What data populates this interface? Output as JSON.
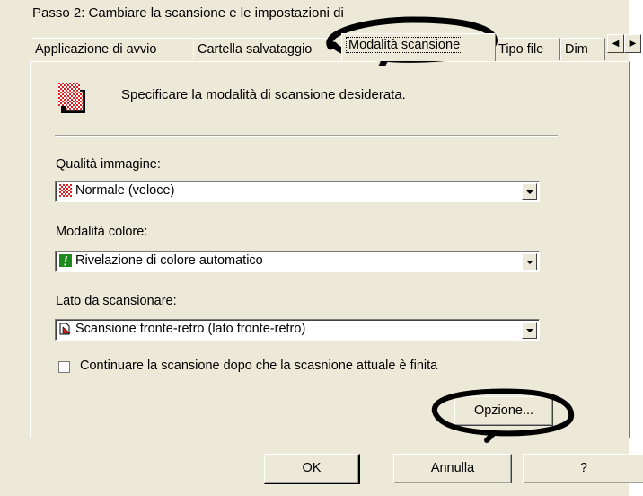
{
  "window": {
    "title": "Passo 2: Cambiare la scansione e le impostazioni di"
  },
  "tabs": [
    {
      "label": "Applicazione di avvio"
    },
    {
      "label": "Cartella salvataggio"
    },
    {
      "label": "Modalità scansione",
      "active": true
    },
    {
      "label": "Tipo file"
    },
    {
      "label": "Dim"
    }
  ],
  "tab_scroll": {
    "left_icon": "triangle-left-icon",
    "right_icon": "triangle-right-icon"
  },
  "header": {
    "icon": "scan-mode-checker-icon",
    "text": "Specificare la modalità di scansione desiderata."
  },
  "image_quality": {
    "label": "Qualità immagine:",
    "value": "Normale (veloce)",
    "icon": "red-checker-icon"
  },
  "color_mode": {
    "label": "Modalità colore:",
    "value": "Rivelazione di colore automatico",
    "icon": "green-exclamation-icon"
  },
  "scan_side": {
    "label": "Lato da scansionare:",
    "value": "Scansione fronte-retro (lato fronte-retro)",
    "icon": "duplex-page-icon"
  },
  "continue_scan": {
    "label": "Continuare la scansione dopo che la scasnione attuale è finita",
    "checked": false
  },
  "buttons": {
    "options": "Opzione...",
    "ok": "OK",
    "cancel": "Annulla",
    "help": "?"
  },
  "annotation_color": "#000000"
}
